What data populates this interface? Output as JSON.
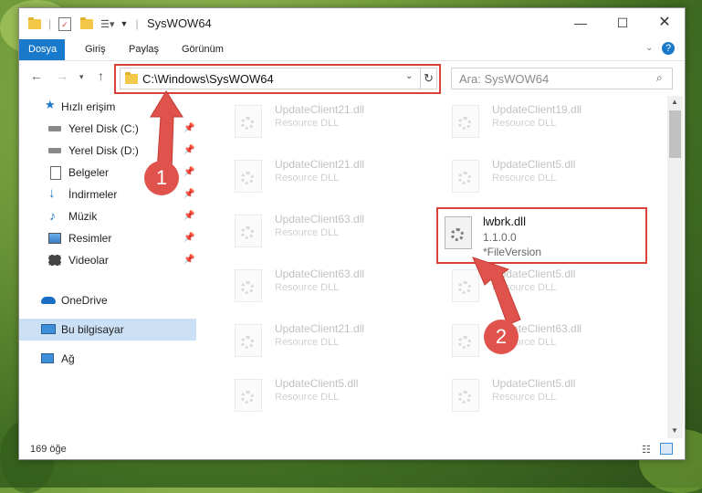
{
  "window": {
    "title": "SysWOW64"
  },
  "ribbon": {
    "tabs": [
      "Dosya",
      "Giriş",
      "Paylaş",
      "Görünüm"
    ]
  },
  "navigation": {
    "address": "C:\\Windows\\SysWOW64",
    "search_placeholder": "Ara: SysWOW64"
  },
  "sidebar": {
    "quick_access": "Hızlı erişim",
    "items": [
      {
        "label": "Yerel Disk (C:)",
        "icon": "drive-icon",
        "pinned": true
      },
      {
        "label": "Yerel Disk (D:)",
        "icon": "drive-icon",
        "pinned": true
      },
      {
        "label": "Belgeler",
        "icon": "documents-icon",
        "pinned": true
      },
      {
        "label": "İndirmeler",
        "icon": "download-icon",
        "pinned": true
      },
      {
        "label": "Müzik",
        "icon": "music-icon",
        "pinned": true
      },
      {
        "label": "Resimler",
        "icon": "pictures-icon",
        "pinned": true
      },
      {
        "label": "Videolar",
        "icon": "videos-icon",
        "pinned": true
      }
    ],
    "onedrive": "OneDrive",
    "this_pc": "Bu bilgisayar",
    "network": "Ağ"
  },
  "files": [
    {
      "name": "UpdateClient21.dll",
      "type": "Resource DLL"
    },
    {
      "name": "UpdateClient19.dll",
      "type": "Resource DLL"
    },
    {
      "name": "UpdateClient21.dll",
      "type": "Resource DLL"
    },
    {
      "name": "UpdateClient5.dll",
      "type": "Resource DLL"
    },
    {
      "name": "UpdateClient63.dll",
      "type": "Resource DLL"
    },
    {
      "name": "lwbrk.dll",
      "version": "1.1.0.0",
      "file_version": "*FileVersion",
      "highlighted": true
    },
    {
      "name": "UpdateClient63.dll",
      "type": "Resource DLL"
    },
    {
      "name": "UpdateClient5.dll",
      "type": "Resource DLL"
    },
    {
      "name": "UpdateClient21.dll",
      "type": "Resource DLL"
    },
    {
      "name": "UpdateClient63.dll",
      "type": "Resource DLL"
    },
    {
      "name": "UpdateClient5.dll",
      "type": "Resource DLL"
    },
    {
      "name": "UpdateClient5.dll",
      "type": "Resource DLL"
    }
  ],
  "status": {
    "count": "169 öğe"
  },
  "annotations": {
    "badge1": "1",
    "badge2": "2",
    "color": "#e0534c"
  }
}
